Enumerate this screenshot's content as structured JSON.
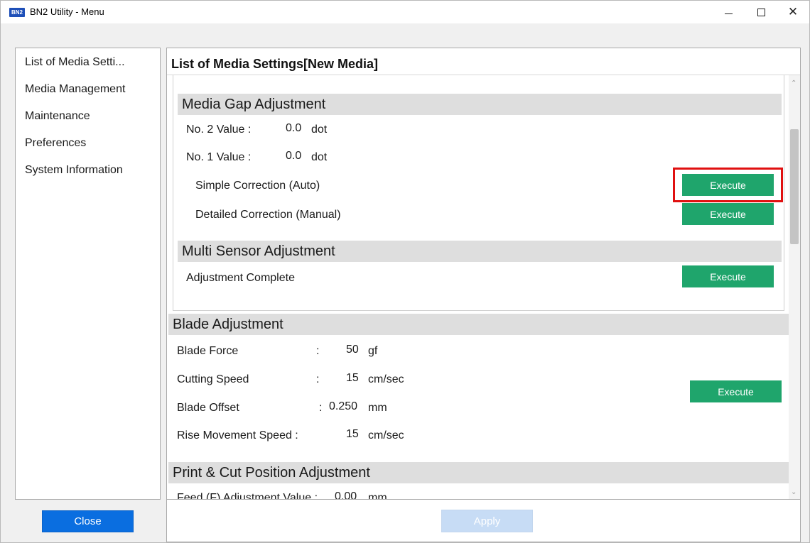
{
  "window": {
    "icon_text": "BN2",
    "title": "BN2 Utility - Menu",
    "minimize_glyph": "",
    "maximize_glyph": "",
    "close_glyph": "✕"
  },
  "sidebar": {
    "items": [
      {
        "label": "List of Media Setti..."
      },
      {
        "label": "Media Management"
      },
      {
        "label": "Maintenance"
      },
      {
        "label": "Preferences"
      },
      {
        "label": "System Information"
      }
    ],
    "close_label": "Close"
  },
  "content": {
    "title": "List of Media Settings[New Media]",
    "media_gap": {
      "heading": "Media Gap Adjustment",
      "no2_label": "No. 2 Value :",
      "no2_value": "0.0",
      "no2_unit": "dot",
      "no1_label": "No. 1 Value :",
      "no1_value": "0.0",
      "no1_unit": "dot",
      "simple_label": "Simple Correction (Auto)",
      "detailed_label": "Detailed Correction (Manual)",
      "execute_label": "Execute"
    },
    "multi_sensor": {
      "heading": "Multi Sensor Adjustment",
      "status_label": "Adjustment Complete",
      "execute_label": "Execute"
    },
    "blade": {
      "heading": "Blade Adjustment",
      "rows": [
        {
          "label": "Blade Force",
          "sep": ":",
          "value": "50",
          "unit": "gf"
        },
        {
          "label": "Cutting Speed",
          "sep": ":",
          "value": "15",
          "unit": "cm/sec"
        },
        {
          "label": "Blade Offset",
          "sep": ":",
          "value": "0.250",
          "unit": "mm"
        },
        {
          "label": "Rise Movement Speed :",
          "sep": "",
          "value": "15",
          "unit": "cm/sec"
        }
      ],
      "execute_label": "Execute"
    },
    "print_cut": {
      "heading": "Print & Cut Position Adjustment",
      "feed_label": "Feed (F) Adjustment Value :",
      "feed_value": "0.00",
      "feed_unit": "mm"
    },
    "apply_label": "Apply"
  },
  "colors": {
    "execute_green": "#1fa56c",
    "close_blue": "#0a6ee0",
    "apply_disabled": "#c7dcf5",
    "highlight_red": "#e01010",
    "section_gray": "#dedede"
  }
}
